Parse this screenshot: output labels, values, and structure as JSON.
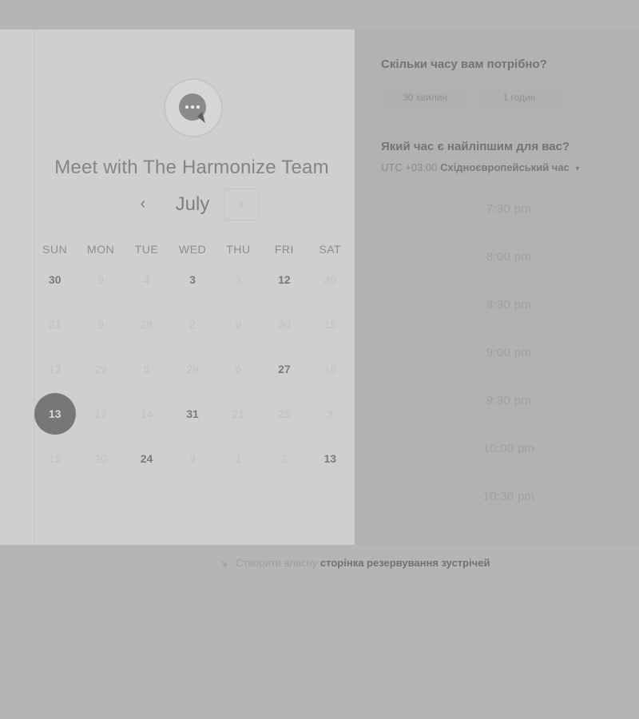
{
  "header": {
    "title": "Meet with The Harmonize Team"
  },
  "calendar": {
    "month": "July",
    "weekdays": [
      "SUN",
      "MON",
      "TUE",
      "WED",
      "THU",
      "FRI",
      "SAT"
    ],
    "days": [
      {
        "label": "30",
        "available": true
      },
      {
        "label": "9",
        "available": false
      },
      {
        "label": "4",
        "available": false
      },
      {
        "label": "3",
        "available": true
      },
      {
        "label": "3",
        "available": false
      },
      {
        "label": "12",
        "available": true
      },
      {
        "label": "30",
        "available": false
      },
      {
        "label": "21",
        "available": false
      },
      {
        "label": "9",
        "available": false
      },
      {
        "label": "28",
        "available": false
      },
      {
        "label": "2",
        "available": false
      },
      {
        "label": "9",
        "available": false
      },
      {
        "label": "30",
        "available": false
      },
      {
        "label": "15",
        "available": false
      },
      {
        "label": "13",
        "available": false
      },
      {
        "label": "29",
        "available": false
      },
      {
        "label": "5",
        "available": false
      },
      {
        "label": "29",
        "available": false
      },
      {
        "label": "6",
        "available": false
      },
      {
        "label": "27",
        "available": true
      },
      {
        "label": "16",
        "available": false
      },
      {
        "label": "13",
        "available": true,
        "selected": true
      },
      {
        "label": "17",
        "available": false
      },
      {
        "label": "14",
        "available": false
      },
      {
        "label": "31",
        "available": true
      },
      {
        "label": "21",
        "available": false
      },
      {
        "label": "25",
        "available": false
      },
      {
        "label": "3",
        "available": false
      },
      {
        "label": "15",
        "available": false
      },
      {
        "label": "20",
        "available": false
      },
      {
        "label": "24",
        "available": true
      },
      {
        "label": "9",
        "available": false
      },
      {
        "label": "1",
        "available": false
      },
      {
        "label": "2",
        "available": false
      },
      {
        "label": "13",
        "available": true
      }
    ]
  },
  "duration": {
    "question": "Скільки часу вам потрібно?",
    "options": [
      "30 хвилин",
      "1 годин"
    ]
  },
  "time": {
    "question": "Який час є найліпшим для вас?",
    "timezone_offset": "UTC +03:00",
    "timezone_name": "Східноєвропейський час",
    "slots": [
      "7:30 pm",
      "8:00 pm",
      "8:30 pm",
      "9:00 pm",
      "9:30 pm",
      "10:00 pm",
      "10:30 pm"
    ]
  },
  "footer": {
    "prefix": "Створити власну",
    "link": "сторінка резервування зустрічей"
  },
  "icons": {
    "avatar": "chat-bubble-icon",
    "prev": "chevron-left-icon",
    "next": "chevron-right-icon",
    "tz_caret": "caret-down-icon",
    "footer": "pointer-icon"
  }
}
